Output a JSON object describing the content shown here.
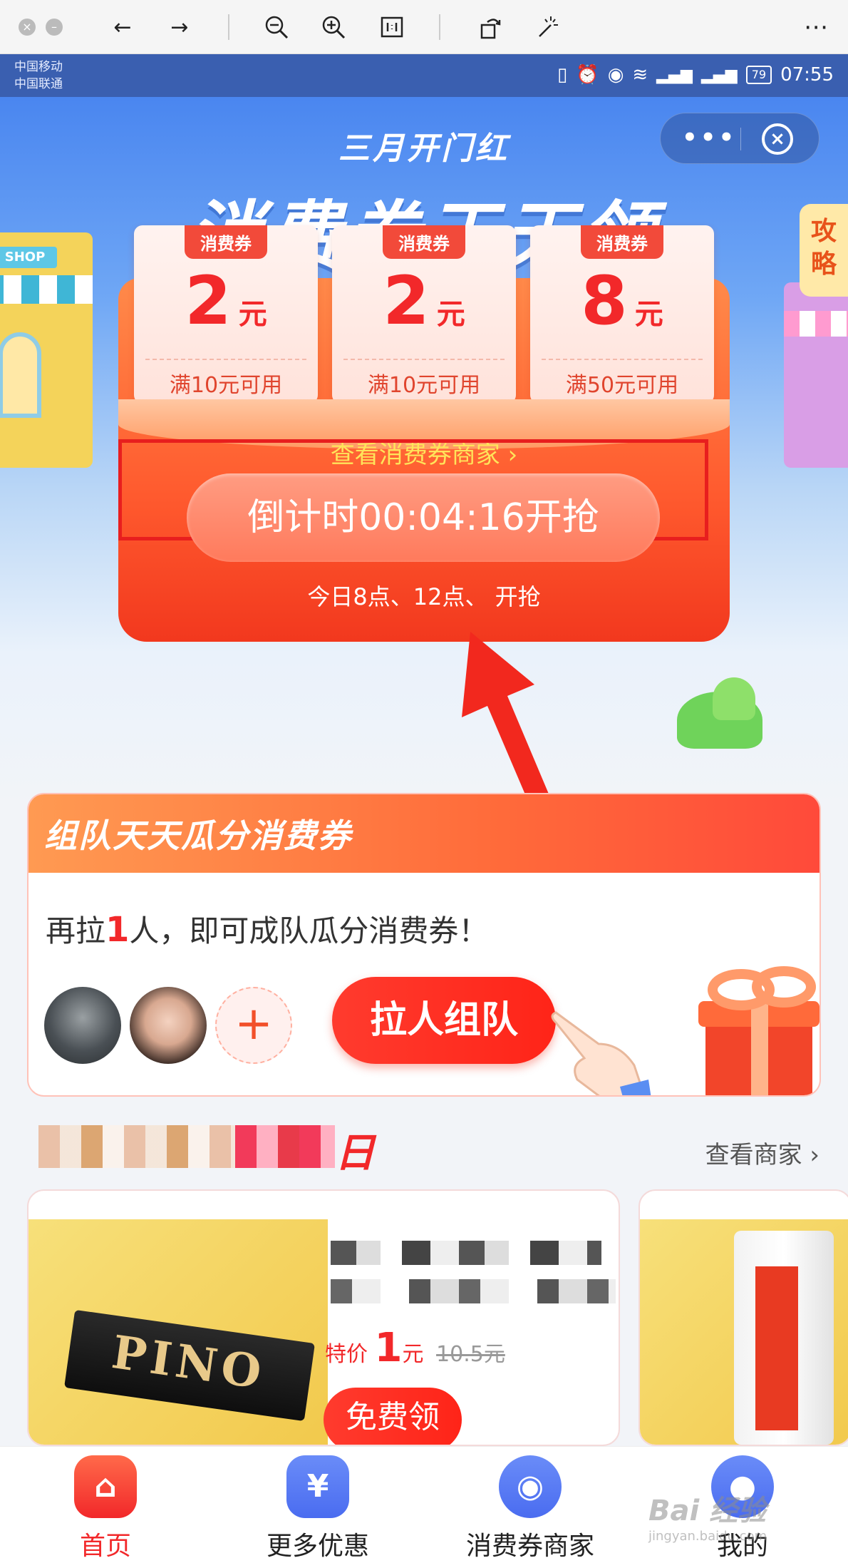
{
  "status_bar": {
    "carrier1": "中国移动",
    "carrier2": "中国联通",
    "battery": "79",
    "time": "07:55"
  },
  "hero": {
    "top_title": "三月开门红",
    "main_title": "消费券天天领",
    "strategy_tab": "攻略",
    "coupons": [
      {
        "tag": "消费券",
        "amount": "2",
        "unit": "元",
        "condition": "满10元可用"
      },
      {
        "tag": "消费券",
        "amount": "2",
        "unit": "元",
        "condition": "满10元可用"
      },
      {
        "tag": "消费券",
        "amount": "8",
        "unit": "元",
        "condition": "满50元可用"
      }
    ],
    "view_merchants": "查看消费券商家 ›",
    "countdown": "倒计时00:04:16开抢",
    "schedule": "今日8点、12点、 开抢"
  },
  "team": {
    "title": "组队天天瓜分消费券",
    "msg_prefix": "再拉",
    "msg_num": "1",
    "msg_suffix": "人，即可成队瓜分消费券！",
    "add_symbol": "+",
    "button": "拉人组队"
  },
  "merchants": {
    "section_suffix": "日",
    "view_link": "查看商家 ›",
    "product": {
      "brand": "PINO",
      "price_label": "特价",
      "price": "1",
      "price_unit": "元",
      "old_price": "10.5元",
      "button": "免费领"
    }
  },
  "bottom_nav": [
    {
      "label": "首页",
      "icon": "home-icon",
      "color": "#f2282a"
    },
    {
      "label": "更多优惠",
      "icon": "yen-coupon-icon",
      "color": "#4a6cf0"
    },
    {
      "label": "消费券商家",
      "icon": "location-pin-icon",
      "color": "#4a6cf0"
    },
    {
      "label": "我的",
      "icon": "user-icon",
      "color": "#4a6cf0"
    }
  ],
  "watermark": {
    "main": "Bai 经验",
    "sub": "jingyan.baidu.com"
  }
}
